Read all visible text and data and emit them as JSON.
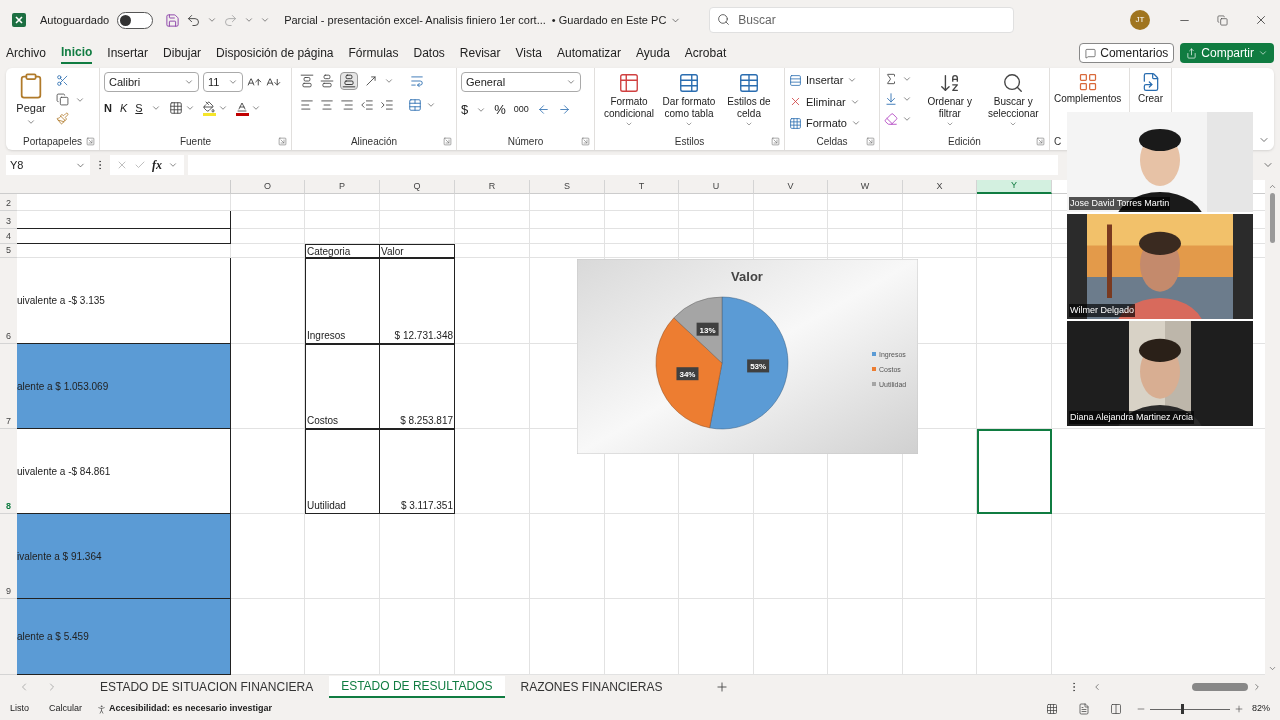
{
  "title_bar": {
    "autosave_label": "Autoguardado",
    "autosave_on": false,
    "document_title": "Parcial - presentación excel- Analisis finiero 1er cort...",
    "save_status": "• Guardado en Este PC",
    "search_placeholder": "Buscar",
    "avatar_initials": "JT"
  },
  "menu_tabs": [
    {
      "label": "Archivo",
      "selected": false
    },
    {
      "label": "Inicio",
      "selected": true
    },
    {
      "label": "Insertar",
      "selected": false
    },
    {
      "label": "Dibujar",
      "selected": false
    },
    {
      "label": "Disposición de página",
      "selected": false
    },
    {
      "label": "Fórmulas",
      "selected": false
    },
    {
      "label": "Datos",
      "selected": false
    },
    {
      "label": "Revisar",
      "selected": false
    },
    {
      "label": "Vista",
      "selected": false
    },
    {
      "label": "Automatizar",
      "selected": false
    },
    {
      "label": "Ayuda",
      "selected": false
    },
    {
      "label": "Acrobat",
      "selected": false
    }
  ],
  "comments_button": "Comentarios",
  "share_button": "Compartir",
  "ribbon": {
    "paste": "Pegar",
    "clipboard_group": "Portapapeles",
    "font_name": "Calibri",
    "font_size": "11",
    "bold": "N",
    "italic": "K",
    "underline": "S",
    "font_group": "Fuente",
    "alignment_group": "Alineación",
    "number_format": "General",
    "currency": "$",
    "percent": "%",
    "thousands": "000",
    "number_group": "Número",
    "styles": [
      "Formato condicional",
      "Dar formato como tabla",
      "Estilos de celda"
    ],
    "styles_group": "Estilos",
    "cells": [
      "Insertar",
      "Eliminar",
      "Formato"
    ],
    "cells_group": "Celdas",
    "editing": [
      "Ordenar y filtrar",
      "Buscar y seleccionar"
    ],
    "editing_group": "Edición",
    "addins": "Complementos",
    "create": "Crear",
    "partial_group": "C"
  },
  "formula_bar": {
    "name_box": "Y8",
    "function_label": "fx"
  },
  "sheet": {
    "columns": [
      {
        "label": "O",
        "selected": false
      },
      {
        "label": "P",
        "selected": false
      },
      {
        "label": "Q",
        "selected": false
      },
      {
        "label": "R",
        "selected": false
      },
      {
        "label": "S",
        "selected": false
      },
      {
        "label": "T",
        "selected": false
      },
      {
        "label": "U",
        "selected": false
      },
      {
        "label": "V",
        "selected": false
      },
      {
        "label": "W",
        "selected": false
      },
      {
        "label": "X",
        "selected": false
      },
      {
        "label": "Y",
        "selected": true
      }
    ],
    "rows": [
      {
        "number": "2",
        "boxed": false,
        "highlighted": false,
        "selected": false
      },
      {
        "number": "3",
        "boxed": true,
        "highlighted": false,
        "selected": false
      },
      {
        "number": "4",
        "boxed": true,
        "highlighted": false,
        "selected": false
      },
      {
        "number": "5",
        "boxed": false,
        "highlighted": false,
        "selected": false,
        "category": "Categoria",
        "value": "Valor"
      },
      {
        "number": "6",
        "boxed": true,
        "highlighted": false,
        "selected": false,
        "note": "uivalente a -$ 3.135",
        "category": "Ingresos",
        "value": "$ 12.731.348"
      },
      {
        "number": "7",
        "boxed": true,
        "highlighted": true,
        "selected": false,
        "note": "alente a $ 1.053.069",
        "category": "Costos",
        "value": "$ 8.253.817"
      },
      {
        "number": "8",
        "boxed": true,
        "highlighted": false,
        "selected": true,
        "note": "uivalente a -$ 84.861",
        "category": "Uutilidad",
        "value": "$ 3.117.351"
      },
      {
        "number": "9",
        "boxed": true,
        "highlighted": true,
        "selected": false,
        "note": "ivalente a $ 91.364"
      },
      {
        "boxed": true,
        "highlighted": true,
        "selected": false,
        "note": "alente a $ 5.459"
      }
    ]
  },
  "chart": {
    "chart_data": {
      "type": "pie",
      "title": "Valor",
      "categories": [
        "Ingresos",
        "Costos",
        "Uutilidad"
      ],
      "colors": [
        "#5b9bd5",
        "#ed7d31",
        "#a5a5a5"
      ],
      "series": [
        {
          "values": [
            53,
            34,
            13
          ]
        }
      ],
      "value_labels": [
        "53%",
        "34%",
        "13%"
      ],
      "legend": "right"
    }
  },
  "participants": [
    {
      "name": "Jose David Torres Martin"
    },
    {
      "name": "Wilmer Delgado"
    },
    {
      "name": "Diana Alejandra Martinez Arcia"
    }
  ],
  "sheet_tabs": [
    {
      "label": "ESTADO DE SITUACION FINANCIERA",
      "selected": false
    },
    {
      "label": "ESTADO DE RESULTADOS",
      "selected": true
    },
    {
      "label": "RAZONES FINANCIERAS",
      "selected": false
    }
  ],
  "status_bar": {
    "ready": "Listo",
    "calculate": "Calcular",
    "accessibility": "Accesibilidad: es necesario investigar",
    "zoom": {
      "level": 0.4,
      "reading": "82%"
    }
  }
}
